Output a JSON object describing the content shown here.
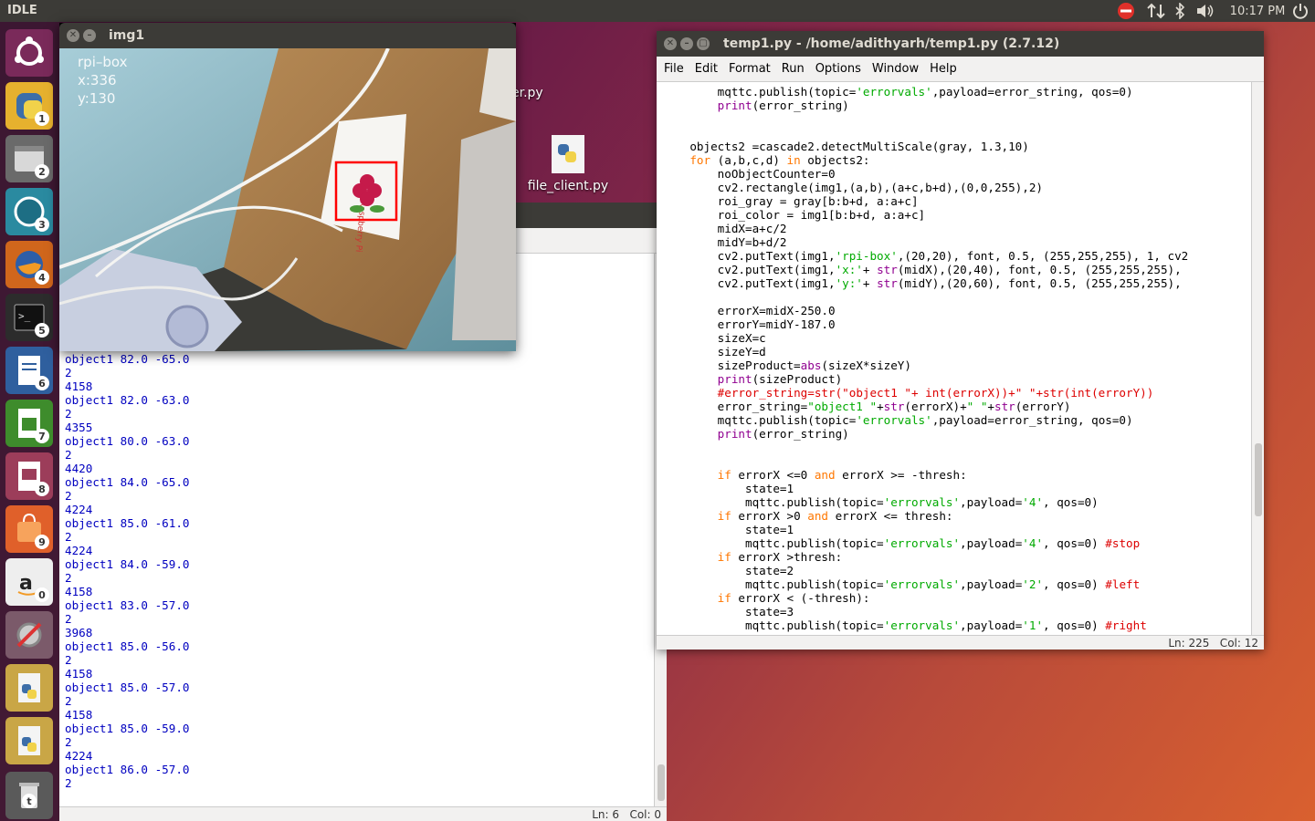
{
  "top_panel": {
    "app_name": "IDLE",
    "clock": "10:17 PM"
  },
  "launcher": {
    "items": [
      {
        "name": "ubuntu-dash",
        "badge": ""
      },
      {
        "name": "workspace-1",
        "badge": "1"
      },
      {
        "name": "workspace-2",
        "badge": "2"
      },
      {
        "name": "workspace-3",
        "badge": "3"
      },
      {
        "name": "firefox",
        "badge": "4"
      },
      {
        "name": "terminal",
        "badge": "5"
      },
      {
        "name": "writer",
        "badge": "6"
      },
      {
        "name": "calc",
        "badge": "7"
      },
      {
        "name": "impress",
        "badge": "8"
      },
      {
        "name": "software",
        "badge": "9"
      },
      {
        "name": "amazon",
        "badge": "0"
      },
      {
        "name": "settings",
        "badge": ""
      },
      {
        "name": "python-1",
        "badge": ""
      },
      {
        "name": "python-2",
        "badge": ""
      },
      {
        "name": "trash",
        "badge": "t"
      }
    ]
  },
  "desktop": {
    "icon1_label": "er.py",
    "icon2_label": "file_client.py"
  },
  "img1": {
    "title": "img1",
    "overlay_label": "rpi–box",
    "overlay_x": "x:336",
    "overlay_y": "y:130",
    "card_text": "Raspberry Pi"
  },
  "shell": {
    "output_lines": [
      "object1 82.0 -65.0",
      "2",
      "4158",
      "object1 82.0 -63.0",
      "2",
      "4355",
      "object1 80.0 -63.0",
      "2",
      "4420",
      "object1 84.0 -65.0",
      "2",
      "4224",
      "object1 85.0 -61.0",
      "2",
      "4224",
      "object1 84.0 -59.0",
      "2",
      "4158",
      "object1 83.0 -57.0",
      "2",
      "3968",
      "object1 85.0 -56.0",
      "2",
      "4158",
      "object1 85.0 -57.0",
      "2",
      "4158",
      "object1 85.0 -59.0",
      "2",
      "4224",
      "object1 86.0 -57.0",
      "2"
    ],
    "status": "Ln: 6   Col: 0"
  },
  "editor": {
    "title": "temp1.py - /home/adithyarh/temp1.py (2.7.12)",
    "menu": [
      "File",
      "Edit",
      "Format",
      "Run",
      "Options",
      "Window",
      "Help"
    ],
    "status": "Ln: 225   Col: 12",
    "code_lines": [
      "        mqttc.publish(topic='errorvals',payload=error_string, qos=0)",
      "        print(error_string)",
      "",
      "",
      "    objects2 =cascade2.detectMultiScale(gray, 1.3,10)",
      "    for (a,b,c,d) in objects2:",
      "        noObjectCounter=0",
      "        cv2.rectangle(img1,(a,b),(a+c,b+d),(0,0,255),2)",
      "        roi_gray = gray[b:b+d, a:a+c]",
      "        roi_color = img1[b:b+d, a:a+c]",
      "        midX=a+c/2",
      "        midY=b+d/2",
      "        cv2.putText(img1,'rpi-box',(20,20), font, 0.5, (255,255,255), 1, cv2",
      "        cv2.putText(img1,'x:'+ str(midX),(20,40), font, 0.5, (255,255,255),",
      "        cv2.putText(img1,'y:'+ str(midY),(20,60), font, 0.5, (255,255,255),",
      "",
      "        errorX=midX-250.0",
      "        errorY=midY-187.0",
      "        sizeX=c",
      "        sizeY=d",
      "        sizeProduct=abs(sizeX*sizeY)",
      "        print(sizeProduct)",
      "        #error_string=str(\"object1 \"+ int(errorX))+\" \"+str(int(errorY))",
      "        error_string=\"object1 \"+str(errorX)+\" \"+str(errorY)",
      "        mqttc.publish(topic='errorvals',payload=error_string, qos=0)",
      "        print(error_string)",
      "",
      "",
      "        if errorX <=0 and errorX >= -thresh:",
      "            state=1",
      "            mqttc.publish(topic='errorvals',payload='4', qos=0)",
      "        if errorX >0 and errorX <= thresh:",
      "            state=1",
      "            mqttc.publish(topic='errorvals',payload='4', qos=0) #stop",
      "        if errorX >thresh:",
      "            state=2",
      "            mqttc.publish(topic='errorvals',payload='2', qos=0) #left",
      "        if errorX < (-thresh):",
      "            state=3",
      "            mqttc.publish(topic='errorvals',payload='1', qos=0) #right"
    ]
  }
}
